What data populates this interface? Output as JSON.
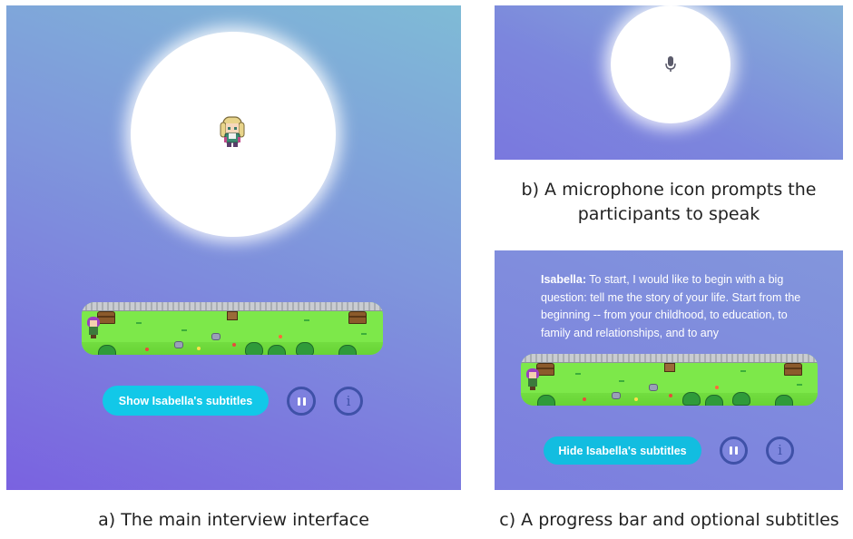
{
  "panel_a": {
    "avatar_name": "isabella-avatar",
    "show_subtitles_label": "Show Isabella's subtitles",
    "pause_icon": "pause-icon",
    "info_label": "i",
    "caption": "a) The main interview interface"
  },
  "panel_b": {
    "mic_icon": "microphone-icon",
    "caption_line1": "b) A microphone icon prompts the",
    "caption_line2": "participants to speak"
  },
  "panel_c": {
    "subtitle_speaker": "Isabella:",
    "subtitle_text": " To start, I would like to begin with a big question: tell me the story of your life. Start from the beginning -- from your childhood, to education, to family and relationships, and to any",
    "hide_subtitles_label": "Hide Isabella's subtitles",
    "info_label": "i",
    "caption": "c) A progress bar and optional subtitles"
  },
  "colors": {
    "accent_button": "#12c8e8",
    "control_ring": "#3f51a8",
    "grass": "#7de84a"
  }
}
